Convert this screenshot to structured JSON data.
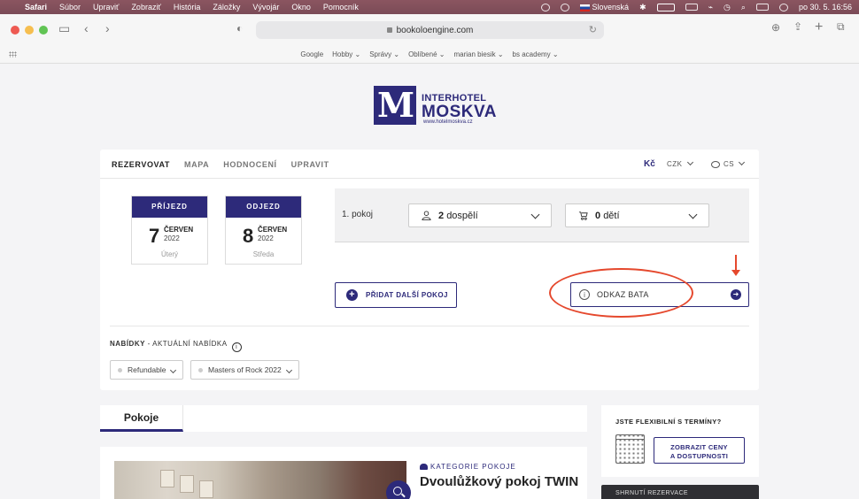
{
  "menubar": {
    "app": "Safari",
    "items": [
      "Súbor",
      "Upraviť",
      "Zobraziť",
      "História",
      "Záložky",
      "Vývojár",
      "Okno",
      "Pomocník"
    ],
    "input_source": "Slovenská",
    "datetime": "po 30. 5.  16:56"
  },
  "browser": {
    "url": "bookoloengine.com",
    "bookmarks": [
      "Google",
      "Hobby",
      "Správy",
      "Oblíbené",
      "marian biesik",
      "bs academy"
    ]
  },
  "logo": {
    "line1": "INTERHOTEL",
    "line2": "MOSKVA",
    "url": "www.hotelmoskva.cz"
  },
  "nav": {
    "tabs": [
      "REZERVOVAT",
      "MAPA",
      "HODNOCENÍ",
      "UPRAVIT"
    ],
    "currency_symbol": "Kč",
    "currency": "CZK",
    "language": "CS"
  },
  "arrival": {
    "header": "PŘÍJEZD",
    "day": "7",
    "month": "ČERVEN",
    "year": "2022",
    "weekday": "Úterý"
  },
  "departure": {
    "header": "ODJEZD",
    "day": "8",
    "month": "ČERVEN",
    "year": "2022",
    "weekday": "Středa"
  },
  "room": {
    "label": "1. pokoj",
    "adults_count": "2",
    "adults_label": "dospělí",
    "children_count": "0",
    "children_label": "dětí"
  },
  "buttons": {
    "add_room": "PŘIDAT DALŠÍ POKOJ",
    "odkaz": "ODKAZ BATA",
    "show_prices_line1": "ZOBRAZIT CENY",
    "show_prices_line2": "A DOSTUPNOSTI"
  },
  "offers": {
    "title": "NABÍDKY",
    "subtitle": " - AKTUÁLNÍ NABÍDKA",
    "chips": [
      "Refundable",
      "Masters of Rock 2022"
    ]
  },
  "rooms_section": {
    "tab": "Pokoje",
    "category": "KATEGORIE POKOJE",
    "room_name": "Dvoulůžkový pokoj TWIN"
  },
  "flexible": {
    "title": "JSTE FLEXIBILNÍ S TERMÍNY?"
  },
  "summary": {
    "title": "SHRNUTÍ REZERVACE"
  },
  "colors": {
    "brand": "#2d2a7a",
    "annotation": "#e5482d"
  }
}
